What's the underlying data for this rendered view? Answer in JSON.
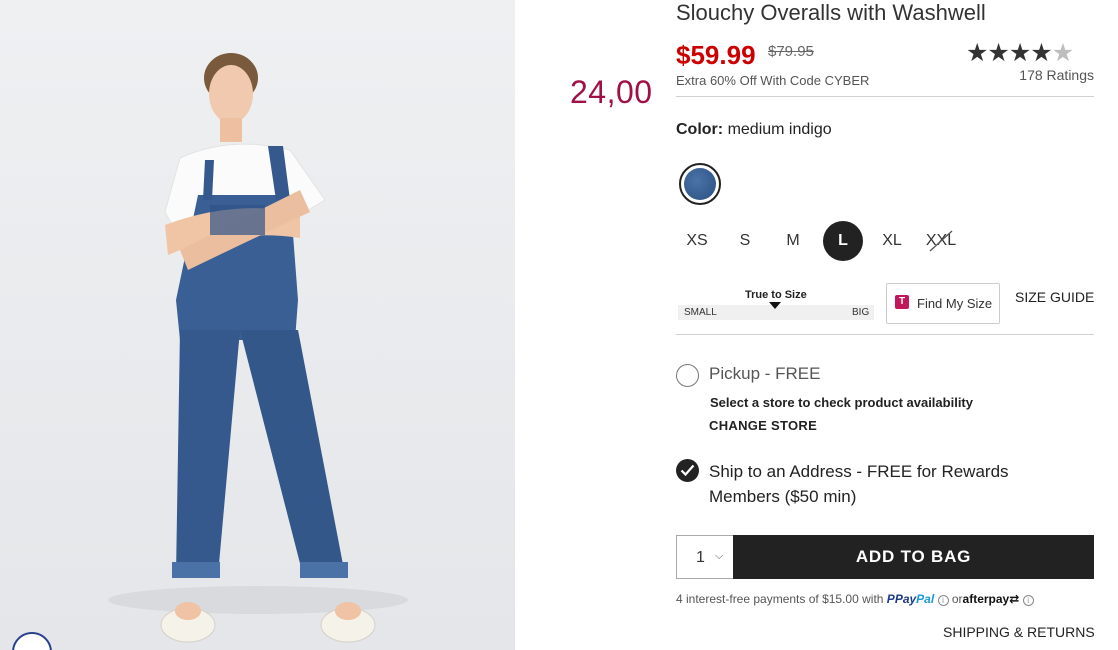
{
  "product": {
    "title": "Slouchy Overalls with Washwell",
    "price_now": "$59.99",
    "price_was": "$79.95",
    "promo": "Extra 60% Off With Code CYBER",
    "rating_stars": 4,
    "rating_max": 5,
    "ratings_count": "178 Ratings",
    "overlay_price": "24,00"
  },
  "color": {
    "label": "Color:",
    "value": "medium indigo",
    "swatch_color": "#3a5f94"
  },
  "sizes": [
    {
      "label": "XS",
      "selected": false,
      "sold_out": false
    },
    {
      "label": "S",
      "selected": false,
      "sold_out": false
    },
    {
      "label": "M",
      "selected": false,
      "sold_out": false
    },
    {
      "label": "L",
      "selected": true,
      "sold_out": false
    },
    {
      "label": "XL",
      "selected": false,
      "sold_out": false
    },
    {
      "label": "XXL",
      "selected": false,
      "sold_out": true
    }
  ],
  "fit": {
    "title": "True to Size",
    "small": "SMALL",
    "big": "BIG",
    "find_my_size": "Find My Size",
    "size_guide": "SIZE GUIDE"
  },
  "fulfillment": {
    "pickup_label": "Pickup - FREE",
    "pickup_sub": "Select a store to check product availability",
    "change_store": "CHANGE STORE",
    "ship_label": "Ship to an Address - FREE for Rewards Members ($50 min)",
    "selected": "ship"
  },
  "purchase": {
    "quantity": "1",
    "add_to_bag": "ADD TO BAG",
    "installments_text": "4 interest-free payments of $15.00 with",
    "paypal_a": "Pay",
    "paypal_b": "Pal",
    "or": "or",
    "afterpay": "afterpay",
    "shipping_returns": "SHIPPING & RETURNS"
  },
  "colors": {
    "sale_red": "#cc0000",
    "overlay_price": "#a01047",
    "primary_dark": "#222222"
  }
}
